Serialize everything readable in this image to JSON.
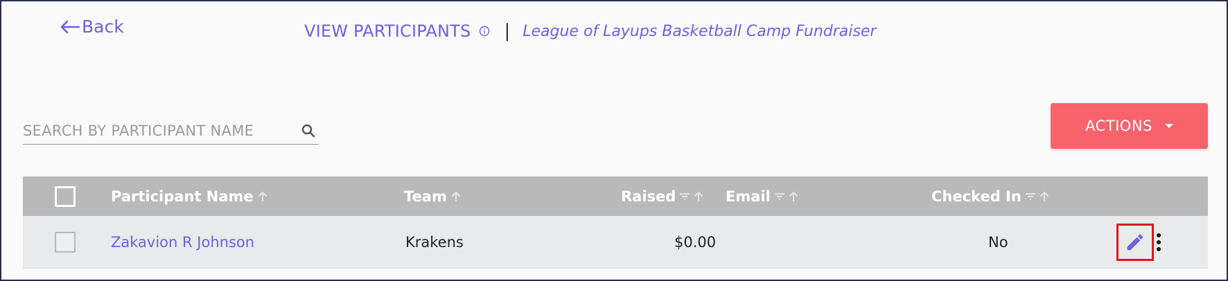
{
  "header": {
    "back_label": "Back",
    "title": "VIEW PARTICIPANTS",
    "separator": "|",
    "event_name": "League of Layups Basketball Camp Fundraiser"
  },
  "search": {
    "placeholder": "SEARCH BY PARTICIPANT NAME",
    "value": ""
  },
  "actions": {
    "label": "ACTIONS"
  },
  "table": {
    "columns": {
      "name": "Participant Name",
      "team": "Team",
      "raised": "Raised",
      "email": "Email",
      "checked_in": "Checked In"
    },
    "rows": [
      {
        "name": "Zakavion R Johnson",
        "team": "Krakens",
        "raised": "$0.00",
        "email": "",
        "checked_in": "No"
      }
    ]
  },
  "colors": {
    "accent": "#6b63d9",
    "actions_button": "#f7636b",
    "header_bg": "#b9b9b9",
    "row_bg": "#e8eaeb",
    "highlight_border": "#e0141e"
  },
  "icons": {
    "back": "arrow-left-icon",
    "info": "info-circle-icon",
    "search": "magnifier-icon",
    "dropdown": "caret-down-icon",
    "sort": "arrow-up-icon",
    "filter": "filter-lines-icon",
    "edit": "pencil-icon",
    "more": "vertical-dots-icon"
  }
}
